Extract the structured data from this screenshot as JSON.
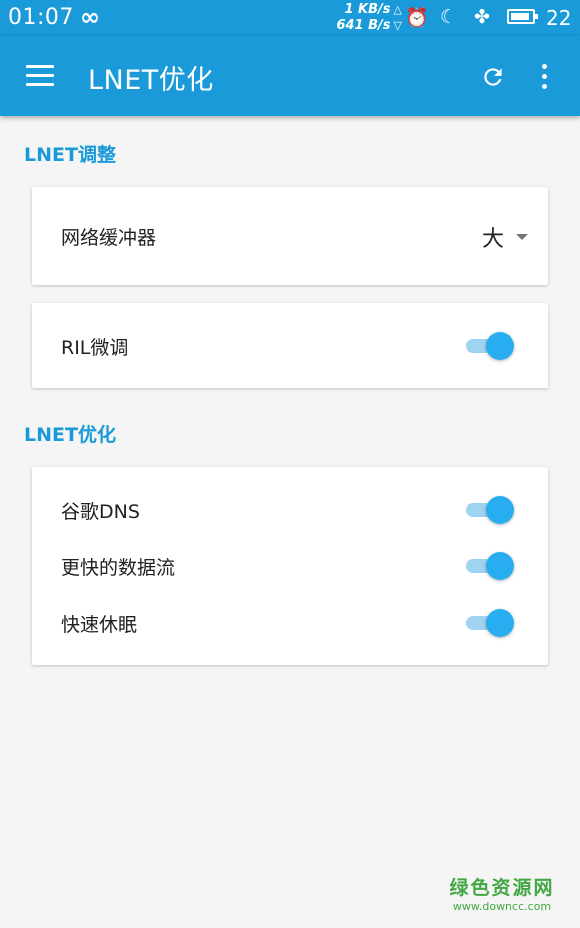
{
  "status_bar": {
    "time": "01:07",
    "infinity": "∞",
    "upload_speed": "1 KB/s",
    "download_speed": "641 B/s",
    "upload_arrow": "△",
    "download_arrow": "▽",
    "alarm_icon": "⏰",
    "dnd_icon": "☾",
    "pinwheel_icon": "✤",
    "battery_level": "22"
  },
  "toolbar": {
    "title": "LNET优化"
  },
  "sections": [
    {
      "header": "LNET调整",
      "cards": [
        {
          "label": "网络缓冲器",
          "value": "大"
        },
        {
          "label": "RIL微调",
          "toggle": true
        }
      ]
    },
    {
      "header": "LNET优化",
      "cards": [
        {
          "label": "谷歌DNS",
          "toggle": true
        },
        {
          "label": "更快的数据流",
          "toggle": true
        },
        {
          "label": "快速休眠",
          "toggle": true
        }
      ]
    }
  ],
  "watermark": {
    "name": "绿色资源网",
    "url": "www.downcc.com"
  },
  "colors": {
    "primary": "#1a9ad8",
    "switch_thumb": "#28aef0",
    "switch_track": "#9fd3f1",
    "watermark": "#43a843"
  }
}
